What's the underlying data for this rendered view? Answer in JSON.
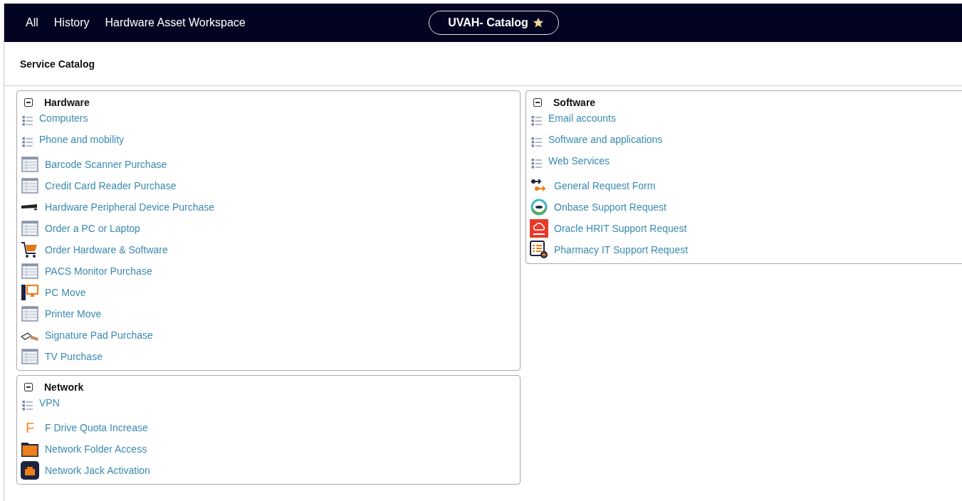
{
  "nav": {
    "links": [
      "All",
      "History",
      "Hardware Asset Workspace"
    ],
    "context": {
      "label": "UVAH- Catalog",
      "starred": true
    }
  },
  "page_title": "Service Catalog",
  "columns": [
    [
      {
        "title": "Hardware",
        "expanded": true,
        "items": [
          {
            "label": "Computers",
            "kind": "category"
          },
          {
            "label": "Phone and mobility",
            "kind": "category"
          },
          {
            "label": "Barcode Scanner Purchase",
            "kind": "form"
          },
          {
            "label": "Credit Card Reader Purchase",
            "kind": "form"
          },
          {
            "label": "Hardware Peripheral Device Purchase",
            "kind": "keyboard"
          },
          {
            "label": "Order a PC or Laptop",
            "kind": "form"
          },
          {
            "label": "Order Hardware & Software",
            "kind": "cart"
          },
          {
            "label": "PACS Monitor Purchase",
            "kind": "form"
          },
          {
            "label": "PC Move",
            "kind": "pc"
          },
          {
            "label": "Printer Move",
            "kind": "form"
          },
          {
            "label": "Signature Pad Purchase",
            "kind": "signature"
          },
          {
            "label": "TV Purchase",
            "kind": "form"
          }
        ]
      },
      {
        "title": "Network",
        "expanded": true,
        "items": [
          {
            "label": "VPN",
            "kind": "category"
          },
          {
            "label": "F Drive Quota Increase",
            "kind": "letter",
            "icon_text": "F"
          },
          {
            "label": "Network Folder Access",
            "kind": "folder"
          },
          {
            "label": "Network Jack Activation",
            "kind": "jack"
          }
        ]
      }
    ],
    [
      {
        "title": "Software",
        "expanded": true,
        "items": [
          {
            "label": "Email accounts",
            "kind": "category"
          },
          {
            "label": "Software and applications",
            "kind": "category"
          },
          {
            "label": "Web Services",
            "kind": "category"
          },
          {
            "label": "General Request Form",
            "kind": "flow"
          },
          {
            "label": "Onbase Support Request",
            "kind": "ring"
          },
          {
            "label": "Oracle HRIT Support Request",
            "kind": "cloud"
          },
          {
            "label": "Pharmacy IT Support Request",
            "kind": "pharmacy"
          }
        ]
      }
    ]
  ]
}
